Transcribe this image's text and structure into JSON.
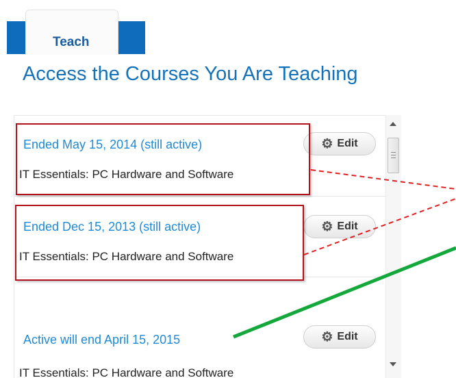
{
  "tabs": [
    {
      "label": "Teach"
    }
  ],
  "heading": "Access the Courses You Are Teaching",
  "courses": [
    {
      "status": "Ended May 15, 2014 (still active)",
      "name": "IT Essentials: PC Hardware and Software",
      "edit_label": "Edit"
    },
    {
      "status": "Ended Dec 15, 2013 (still active)",
      "name": "IT Essentials: PC Hardware and Software",
      "edit_label": "Edit"
    },
    {
      "status": "Active will end April 15, 2015",
      "name": "IT Essentials: PC Hardware and Software",
      "edit_label": "Edit"
    }
  ],
  "icons": {
    "edit": "gear-icon",
    "scroll_up": "scroll-up-arrow-icon",
    "scroll_down": "scroll-down-arrow-icon"
  },
  "colors": {
    "tab_bar": "#0f6cbd",
    "heading": "#1572b9",
    "link": "#1f8ad6",
    "highlight_box": "#b3121d",
    "dashed_callout": "#e02020",
    "active_callout": "#14a83c"
  }
}
